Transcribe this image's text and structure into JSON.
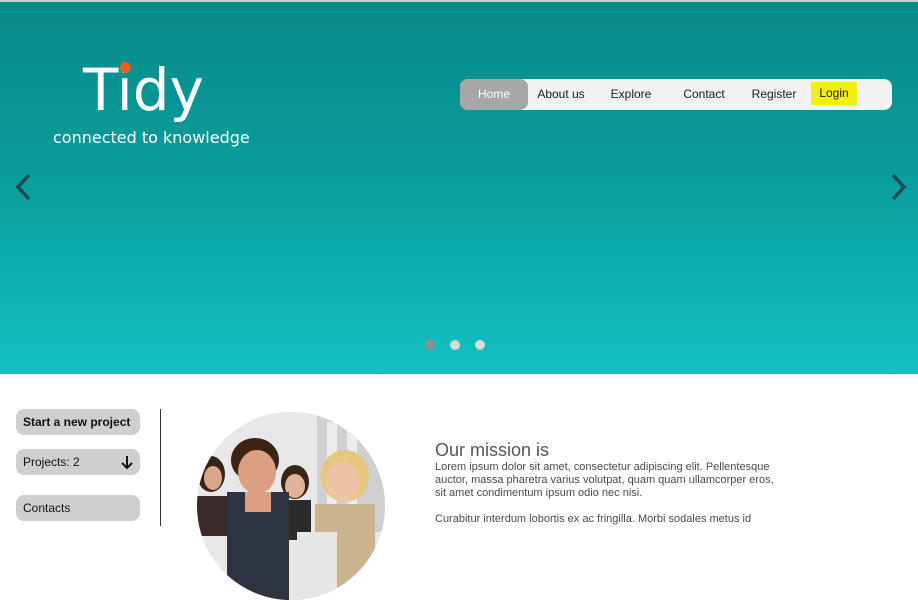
{
  "brand": {
    "logo_text": "Tidy",
    "tagline": "connected to knowledge",
    "accent_color": "#e8611c"
  },
  "nav": {
    "items": [
      {
        "label": "Home",
        "active": true
      },
      {
        "label": "About us"
      },
      {
        "label": "Explore"
      },
      {
        "label": "Contact"
      },
      {
        "label": "Register"
      },
      {
        "label": "Login",
        "highlighted": true
      }
    ]
  },
  "carousel": {
    "slide_count": 3,
    "active_index": 0,
    "prev_icon": "chevron-left-icon",
    "next_icon": "chevron-right-icon"
  },
  "sidebar": {
    "start_project": "Start a new project",
    "projects": "Projects: 2",
    "projects_icon": "arrow-down-icon",
    "contacts": "Contacts"
  },
  "mission": {
    "title": "Our mission is",
    "paragraph1": "Lorem ipsum dolor sit amet, consectetur adipiscing elit. Pellentesque auctor, massa pharetra varius volutpat, quam quam ullamcorper eros, sit amet condimentum ipsum odio nec nisi.",
    "paragraph2": "Curabitur interdum lobortis ex ac fringilla. Morbi sodales metus id"
  },
  "colors": {
    "hero_top": "#078a88",
    "hero_bottom": "#12c1c2",
    "login_highlight": "#f0f00a"
  }
}
